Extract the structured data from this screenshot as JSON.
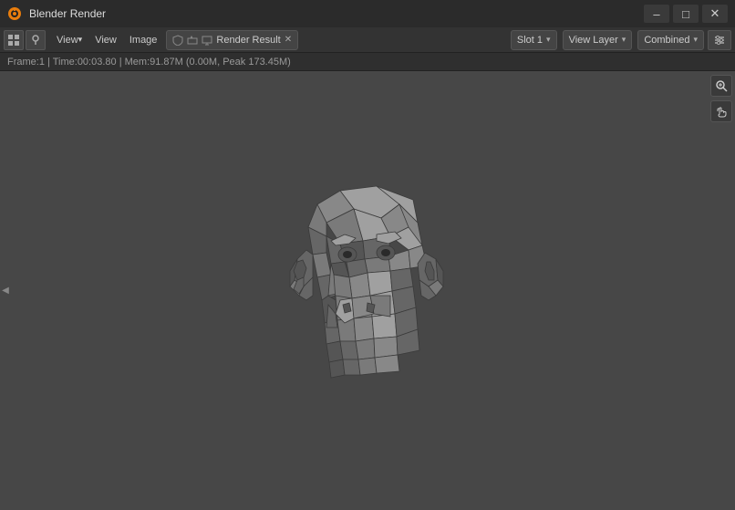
{
  "titleBar": {
    "title": "Blender Render",
    "minimize": "–",
    "maximize": "□",
    "close": "✕"
  },
  "menuBar": {
    "viewBtn1": "View",
    "viewBtn2": "View",
    "imageBtn": "Image",
    "renderResult": "Render Result",
    "slotLabel": "Slot 1",
    "viewLayerLabel": "View Layer",
    "combinedLabel": "Combined"
  },
  "statusBar": {
    "text": "Frame:1 | Time:00:03.80 | Mem:91.87M (0.00M, Peak 173.45M)"
  },
  "rightToolbar": {
    "zoomIcon": "🔍",
    "handIcon": "✋"
  }
}
